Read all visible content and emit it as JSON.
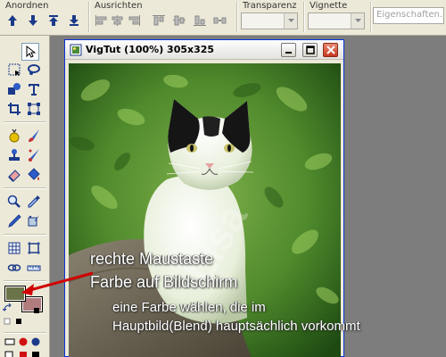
{
  "toolbar": {
    "arrange": {
      "label": "Anordnen",
      "icons": [
        "arrow-up-icon",
        "arrow-down-icon",
        "bring-to-top-icon",
        "send-to-bottom-icon"
      ]
    },
    "align": {
      "label": "Ausrichten",
      "icons": [
        "align-left-icon",
        "align-center-icon",
        "align-right-icon",
        "align-top-icon",
        "align-middle-icon",
        "align-bottom-icon",
        "distribute-icon"
      ]
    },
    "transparency": {
      "label": "Transparenz",
      "value": ""
    },
    "vignette": {
      "label": "Vignette",
      "value": ""
    },
    "properties": {
      "placeholder": "Eigenschaften..."
    }
  },
  "tools": [
    "pointer-tool-icon",
    "marquee-select-icon",
    "lasso-select-icon",
    "shape-tool-icon",
    "text-tool-icon",
    "crop-tool-icon",
    "transform-tool-icon",
    "magic-wand-icon",
    "brush-tool-icon",
    "clone-stamp-icon",
    "healing-brush-icon",
    "eraser-tool-icon",
    "paint-bucket-icon",
    "zoom-tool-icon",
    "eyedropper-icon",
    "pencil-tool-icon",
    "color-replace-icon",
    "grid-icon",
    "frame-icon",
    "link-icon",
    "ruler-icon"
  ],
  "colors": {
    "foreground": "#6b7348",
    "background": "#b07c7e",
    "accent": "#0831d9",
    "arrow": "#d00000"
  },
  "window": {
    "title": "VigTut (100%) 305x325",
    "minimize_icon": "minimize-icon",
    "maximize_icon": "maximize-icon",
    "close_icon": "close-icon"
  },
  "image": {
    "subject": "cat-photo",
    "watermark": "Lisa"
  },
  "annotation": {
    "line1": "rechte Maustaste",
    "line2": "Farbe auf Bildschirm",
    "line3": "eine Farbe wählen, die im",
    "line4": "Hauptbild(Blend) hauptsächlich vorkommt"
  }
}
